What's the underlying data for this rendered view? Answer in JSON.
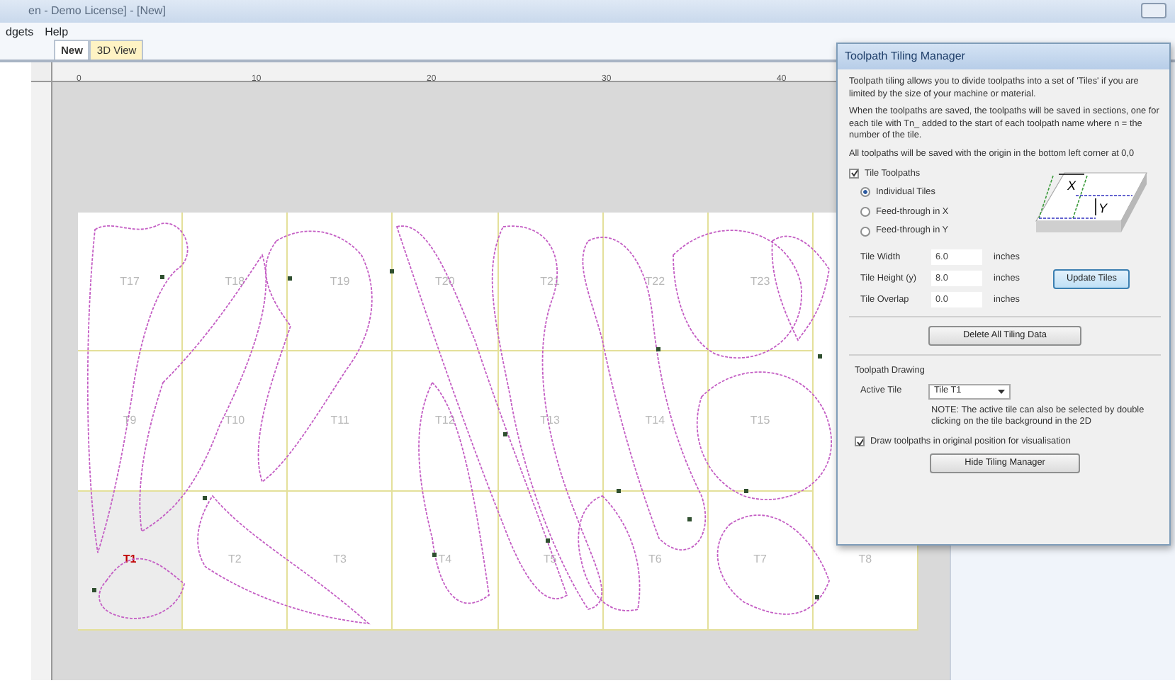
{
  "window": {
    "title": "en - Demo License] - [New]"
  },
  "menu": [
    "dgets",
    "Help"
  ],
  "tabs": [
    {
      "label": "New",
      "selected": true
    },
    {
      "label": "3D View",
      "selected": false
    }
  ],
  "ruler": {
    "labels": [
      "0",
      "10",
      "20",
      "30",
      "40"
    ]
  },
  "tile_rows": [
    [
      {
        "label": "T17",
        "selected": false
      },
      {
        "label": "T18",
        "selected": false
      },
      {
        "label": "T19",
        "selected": false
      },
      {
        "label": "T20",
        "selected": false
      },
      {
        "label": "T21",
        "selected": false
      },
      {
        "label": "T22",
        "selected": false
      },
      {
        "label": "T23",
        "selected": false
      }
    ],
    [
      {
        "label": "T9",
        "selected": false
      },
      {
        "label": "T10",
        "selected": false
      },
      {
        "label": "T11",
        "selected": false
      },
      {
        "label": "T12",
        "selected": false
      },
      {
        "label": "T13",
        "selected": false
      },
      {
        "label": "T14",
        "selected": false
      },
      {
        "label": "T15",
        "selected": false
      }
    ],
    [
      {
        "label": "T1",
        "selected": true
      },
      {
        "label": "T2",
        "selected": false
      },
      {
        "label": "T3",
        "selected": false
      },
      {
        "label": "T4",
        "selected": false
      },
      {
        "label": "T5",
        "selected": false
      },
      {
        "label": "T6",
        "selected": false
      },
      {
        "label": "T7",
        "selected": false
      },
      {
        "label": "T8",
        "selected": false
      }
    ]
  ],
  "dialog": {
    "title": "Toolpath Tiling Manager",
    "paragraphs": [
      "Toolpath tiling allows you to divide toolpaths into a set of 'Tiles' if you are limited by the size of your machine or material.",
      "When the toolpaths are saved, the toolpaths will be saved in sections, one for each tile with Tn_ added to the start of each toolpath name where n = the number of the tile.",
      "All toolpaths will be saved with the origin in the bottom left corner at 0,0"
    ],
    "tile_toolpaths": {
      "label": "Tile Toolpaths",
      "checked": true
    },
    "modes": [
      {
        "label": "Individual Tiles",
        "selected": true
      },
      {
        "label": "Feed-through in X",
        "selected": false
      },
      {
        "label": "Feed-through in Y",
        "selected": false
      }
    ],
    "diagram": {
      "x_label": "X",
      "y_label": "Y"
    },
    "fields": [
      {
        "label": "Tile Width",
        "value": "6.0",
        "unit": "inches"
      },
      {
        "label": "Tile Height (y)",
        "value": "8.0",
        "unit": "inches"
      },
      {
        "label": "Tile Overlap",
        "value": "0.0",
        "unit": "inches"
      }
    ],
    "update_button": "Update Tiles",
    "delete_button": "Delete All Tiling Data",
    "section_title": "Toolpath Drawing",
    "active_tile": {
      "label": "Active Tile",
      "value": "Tile T1"
    },
    "note": "NOTE: The active tile can also be selected by double clicking on the tile background in the 2D",
    "draw_original": {
      "label": "Draw toolpaths in original position for visualisation",
      "checked": true
    },
    "hide_button": "Hide Tiling Manager"
  }
}
